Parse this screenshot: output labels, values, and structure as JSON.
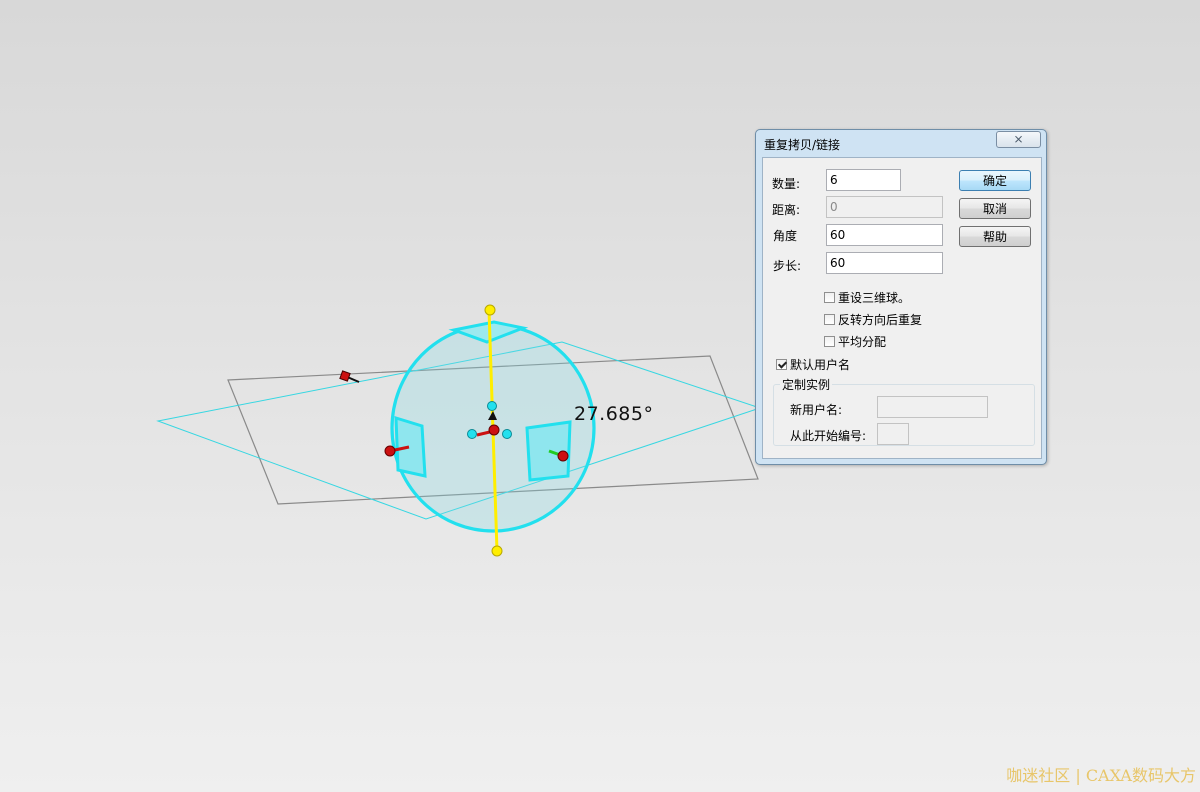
{
  "viewport": {
    "angle_readout": "27.685°"
  },
  "dialog": {
    "title": "重复拷贝/链接",
    "close_glyph": "⨯",
    "fields": {
      "count_label": "数量:",
      "count_value": "6",
      "distance_label": "距离:",
      "distance_value": "0",
      "angle_label": "角度",
      "angle_value": "60",
      "step_label": "步长:",
      "step_value": "60"
    },
    "buttons": {
      "ok": "确定",
      "cancel": "取消",
      "help": "帮助"
    },
    "options": [
      {
        "label": "重设三维球。",
        "checked": false
      },
      {
        "label": "反转方向后重复",
        "checked": false
      },
      {
        "label": "平均分配",
        "checked": false
      }
    ],
    "default_username": {
      "label": "默认用户名",
      "checked": true
    },
    "custom_instance": {
      "title": "定制实例",
      "new_username_label": "新用户名:",
      "new_username_value": "",
      "start_number_label": "从此开始编号:",
      "start_number_value": ""
    }
  },
  "colors": {
    "sphere": "#22e0ee",
    "axis": "#ffee00",
    "handle_red": "#cc1111"
  },
  "watermark": "咖迷社区 | CAXA数码大方"
}
